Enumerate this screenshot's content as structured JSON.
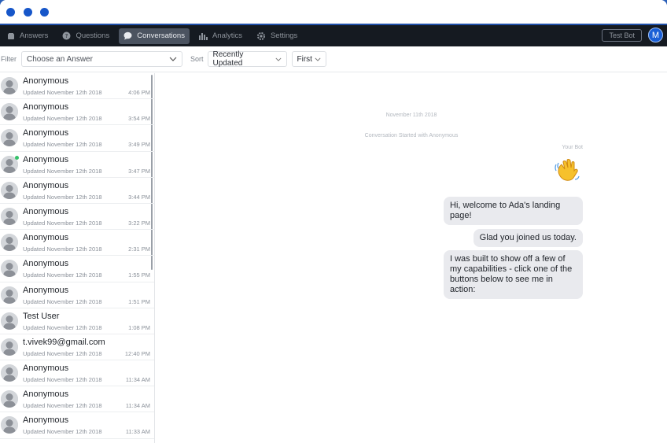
{
  "nav": {
    "items": [
      {
        "label": "Answers",
        "icon": "folder-icon"
      },
      {
        "label": "Questions",
        "icon": "question-bubble-icon"
      },
      {
        "label": "Conversations",
        "icon": "chat-bubble-icon",
        "active": true
      },
      {
        "label": "Analytics",
        "icon": "bar-chart-icon"
      },
      {
        "label": "Settings",
        "icon": "gear-icon"
      }
    ],
    "test_bot_label": "Test Bot",
    "avatar_initial": "M"
  },
  "filters": {
    "filter_label": "Filter",
    "answer_placeholder": "Choose an Answer",
    "sort_label": "Sort",
    "sort_value": "Recently Updated",
    "order_value": "First"
  },
  "conversations": [
    {
      "name": "Anonymous",
      "updated": "Updated November 12th 2018",
      "time": "4:06 PM"
    },
    {
      "name": "Anonymous",
      "updated": "Updated November 12th 2018",
      "time": "3:54 PM"
    },
    {
      "name": "Anonymous",
      "updated": "Updated November 12th 2018",
      "time": "3:49 PM"
    },
    {
      "name": "Anonymous",
      "updated": "Updated November 12th 2018",
      "time": "3:47 PM",
      "online": true
    },
    {
      "name": "Anonymous",
      "updated": "Updated November 12th 2018",
      "time": "3:44 PM"
    },
    {
      "name": "Anonymous",
      "updated": "Updated November 12th 2018",
      "time": "3:22 PM"
    },
    {
      "name": "Anonymous",
      "updated": "Updated November 12th 2018",
      "time": "2:31 PM"
    },
    {
      "name": "Anonymous",
      "updated": "Updated November 12th 2018",
      "time": "1:55 PM"
    },
    {
      "name": "Anonymous",
      "updated": "Updated November 12th 2018",
      "time": "1:51 PM"
    },
    {
      "name": "Test User",
      "updated": "Updated November 12th 2018",
      "time": "1:08 PM"
    },
    {
      "name": "t.vivek99@gmail.com",
      "updated": "Updated November 12th 2018",
      "time": "12:40 PM"
    },
    {
      "name": "Anonymous",
      "updated": "Updated November 12th 2018",
      "time": "11:34 AM"
    },
    {
      "name": "Anonymous",
      "updated": "Updated November 12th 2018",
      "time": "11:34 AM"
    },
    {
      "name": "Anonymous",
      "updated": "Updated November 12th 2018",
      "time": "11:33 AM"
    }
  ],
  "chat": {
    "date": "November 11th 2018",
    "started": "Conversation Started with Anonymous",
    "sender": "Your Bot",
    "emoji": "waving-hand-icon",
    "messages": [
      "Hi, welcome to Ada's landing page!",
      "Glad you joined us today.",
      "I was built to show off a few of my capabilities - click one of the buttons below to see me in action:"
    ]
  }
}
